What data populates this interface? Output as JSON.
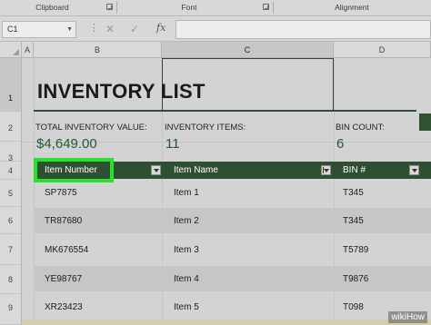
{
  "ribbon": {
    "groups": [
      "Clipboard",
      "Font",
      "Alignment"
    ]
  },
  "formula_bar": {
    "cell_ref": "C1",
    "cancel_glyph": "✕",
    "enter_glyph": "✓",
    "fx_label": "fx",
    "formula": ""
  },
  "columns": [
    "A",
    "B",
    "C",
    "D"
  ],
  "rows": [
    "1",
    "2",
    "3",
    "4",
    "5",
    "6",
    "7",
    "8",
    "9"
  ],
  "sheet": {
    "title": "INVENTORY LIST",
    "stats": [
      {
        "label": "TOTAL INVENTORY VALUE:",
        "value": "$4,649.00"
      },
      {
        "label": "INVENTORY ITEMS:",
        "value": "11"
      },
      {
        "label": "BIN COUNT:",
        "value": "6"
      }
    ],
    "table_headers": [
      "Item Number",
      "Item Name",
      "BIN #"
    ],
    "table_rows": [
      {
        "number": "SP7875",
        "name": "Item 1",
        "bin": "T345"
      },
      {
        "number": "TR87680",
        "name": "Item 2",
        "bin": "T345"
      },
      {
        "number": "MK676554",
        "name": "Item 3",
        "bin": "T5789"
      },
      {
        "number": "YE98767",
        "name": "Item 4",
        "bin": "T9876"
      },
      {
        "number": "XR23423",
        "name": "Item 5",
        "bin": "T098"
      }
    ]
  },
  "watermark": "wikiHow",
  "colors": {
    "header_green": "#2f4f33",
    "value_green": "#1f5a30",
    "highlight": "#27e22b"
  }
}
